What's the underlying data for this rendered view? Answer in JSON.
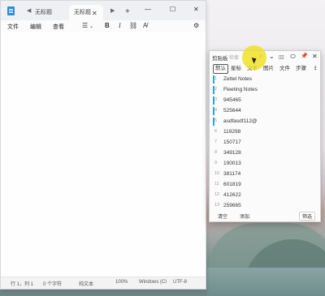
{
  "notepad": {
    "tabs": [
      {
        "label": "无标题"
      },
      {
        "label": "无标题"
      }
    ],
    "tab_close": "✕",
    "tab_add": "+",
    "window_buttons": {
      "minimize": "—",
      "maximize": "☐",
      "close": "✕"
    },
    "menus": {
      "file": "文件",
      "edit": "编辑",
      "view": "查看"
    },
    "toolbar": {
      "list": "☰",
      "bold": "B",
      "italic": "I",
      "link": "⛓",
      "clear": "A̸",
      "settings": "⚙"
    },
    "status": {
      "position": "行 1，列 1",
      "chars": "0 个字符",
      "format": "纯文本",
      "zoom": "100%",
      "line_ending": "Windows (CI",
      "encoding": "UTF-8"
    }
  },
  "clipboard": {
    "title": "剪贴板",
    "search_placeholder": "检索",
    "controls": {
      "expand": "⌄",
      "layout": "▯▯",
      "mouse": "⬭",
      "pin": "📌",
      "close": "✕"
    },
    "tabs": [
      "默认",
      "星标",
      "文本",
      "图片",
      "文件",
      "步骤"
    ],
    "more": "⋮",
    "items": [
      {
        "num": "1",
        "text": "Zettel Notes",
        "marked": true
      },
      {
        "num": "2",
        "text": "Fleeting Notes",
        "marked": true
      },
      {
        "num": "3",
        "text": "945465",
        "marked": true
      },
      {
        "num": "4",
        "text": "525644",
        "marked": true
      },
      {
        "num": "5",
        "text": "asdfasdf112@",
        "marked": true
      },
      {
        "num": "6",
        "text": "119298",
        "marked": false
      },
      {
        "num": "7",
        "text": "150717",
        "marked": false
      },
      {
        "num": "8",
        "text": "349128",
        "marked": false
      },
      {
        "num": "9",
        "text": "190013",
        "marked": false
      },
      {
        "num": "10",
        "text": "381174",
        "marked": false
      },
      {
        "num": "11",
        "text": "601819",
        "marked": false
      },
      {
        "num": "12",
        "text": "412622",
        "marked": false
      },
      {
        "num": "13",
        "text": "259665",
        "marked": false
      }
    ],
    "footer": {
      "clear": "清空",
      "add": "添加",
      "filter": "筛选"
    }
  }
}
